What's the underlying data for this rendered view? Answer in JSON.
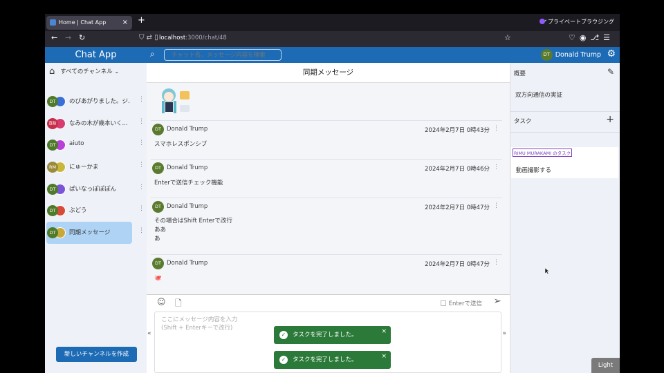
{
  "browser": {
    "tab_title": "Home | Chat App",
    "tab_close": "×",
    "new_tab": "+",
    "private_label": "プライベートブラウジング",
    "url_host": "localhost",
    "url_path": ":3000/chat/48"
  },
  "header": {
    "app_title": "Chat App",
    "search_placeholder": "チャット名、メッセージ内容を検索",
    "user_initials": "DT",
    "user_name": "Donald Trump"
  },
  "sidebar": {
    "channel_filter": "すべてのチャンネル",
    "channels": [
      {
        "initials": "DT",
        "label": "のびあがりました。ジ...",
        "active": false
      },
      {
        "initials": "直結",
        "label": "なみの木が幾本いく...",
        "active": false
      },
      {
        "initials": "DT",
        "label": "aiuto",
        "active": false
      },
      {
        "initials": "RM",
        "label": "にゅーかま",
        "active": false
      },
      {
        "initials": "DT",
        "label": "ぱいなっぽぽぽん",
        "active": false
      },
      {
        "initials": "DT",
        "label": "ぶどう",
        "active": false
      },
      {
        "initials": "DT",
        "label": "同期メッセージ",
        "active": true
      }
    ],
    "create_button": "新しいチャンネルを作成"
  },
  "main": {
    "title": "同期メッセージ",
    "messages": [
      {
        "initials": "DT",
        "author": "Donald Trump",
        "date": "2024年2月7日 0時43分",
        "text": "スマホレスポンシブ"
      },
      {
        "initials": "DT",
        "author": "Donald Trump",
        "date": "2024年2月7日 0時46分",
        "text": "Enterで送信チェック機能"
      },
      {
        "initials": "DT",
        "author": "Donald Trump",
        "date": "2024年2月7日 0時47分",
        "text": "その場合はShift Enterで改行\nああ\nあ"
      },
      {
        "initials": "DT",
        "author": "Donald Trump",
        "date": "2024年2月7日 0時47分",
        "text": "🐙"
      }
    ],
    "enter_send_label": "Enterで送信",
    "input_placeholder": "ここにメッセージ内容を入力\n(Shift + Enterキーで改行)"
  },
  "right_panel": {
    "summary_heading": "概要",
    "summary_text": "双方向通信の実証",
    "task_heading": "タスク",
    "task_user": "RIMU MURAKAMI のタスク",
    "task_text": "動画撮影する"
  },
  "toasts": [
    {
      "text": "タスクを完了しました。"
    },
    {
      "text": "タスクを完了しました。"
    }
  ],
  "theme_button": "Light",
  "colors": {
    "brand": "#1d6bb5",
    "active_channel": "#aed3f5",
    "toast": "#2c7a3a",
    "avatar": "#5a7a2e"
  }
}
